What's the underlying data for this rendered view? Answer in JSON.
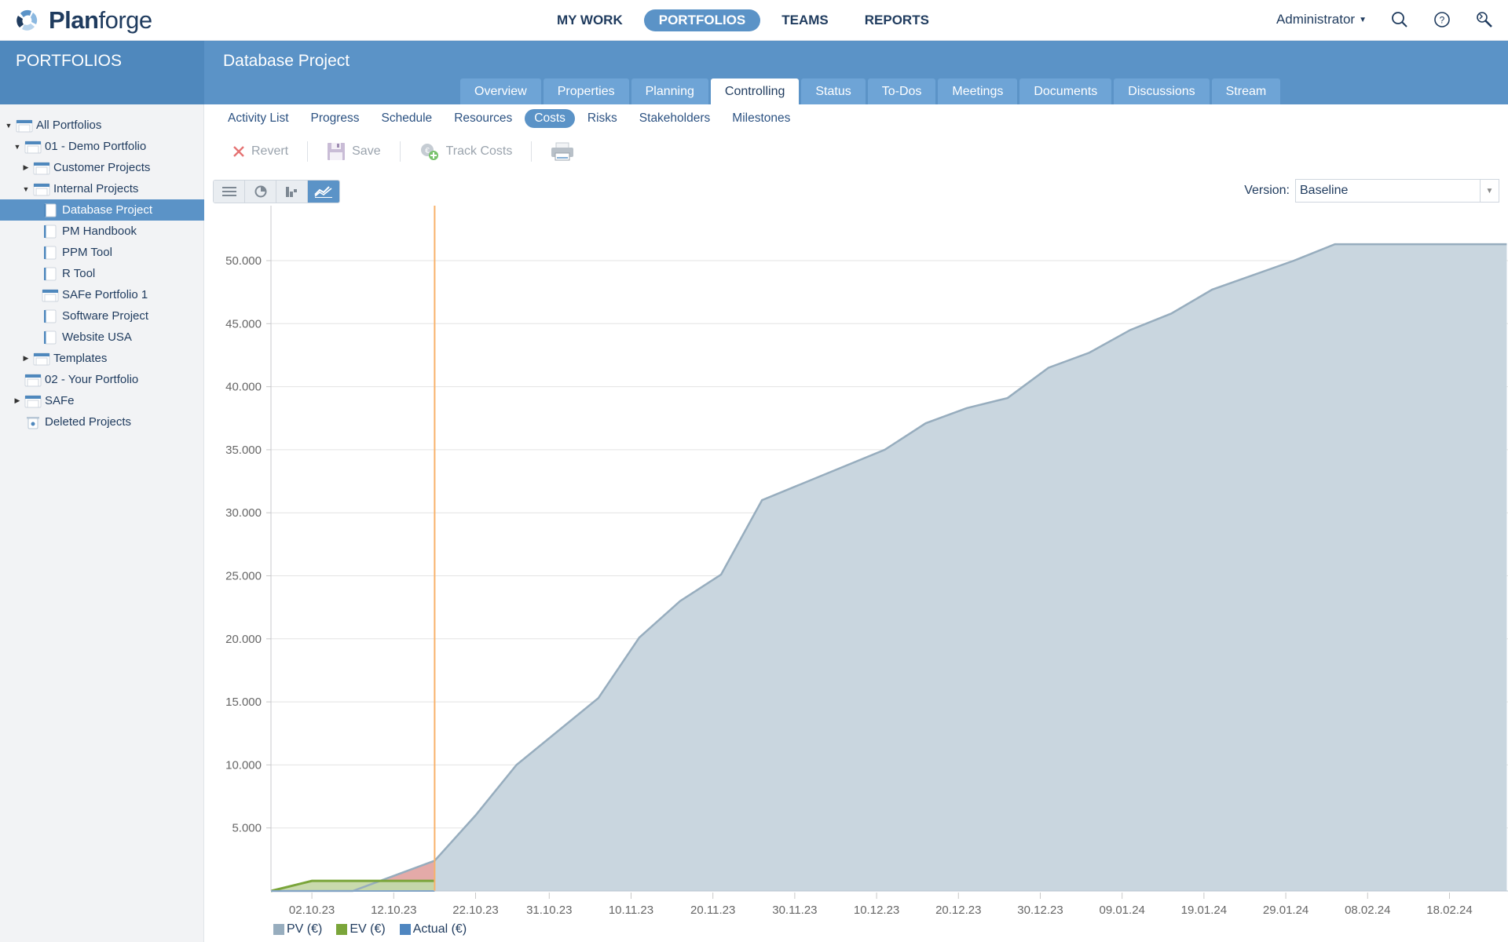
{
  "app": {
    "name_light": "Plan",
    "name_bold": "forge",
    "logo": "planforge-logo-icon"
  },
  "topnav": {
    "items": [
      {
        "label": "MY WORK",
        "active": false
      },
      {
        "label": "PORTFOLIOS",
        "active": true
      },
      {
        "label": "TEAMS",
        "active": false
      },
      {
        "label": "REPORTS",
        "active": false
      }
    ],
    "user": "Administrator",
    "icons": [
      "search-icon",
      "help-icon",
      "wrench-search-icon"
    ]
  },
  "sidebar": {
    "title": "PORTFOLIOS",
    "items": [
      {
        "label": "All Portfolios",
        "level": 0,
        "toggle": "open",
        "icon": "portfolio-icon"
      },
      {
        "label": "01 - Demo Portfolio",
        "level": 1,
        "toggle": "open",
        "icon": "portfolio-icon"
      },
      {
        "label": "Customer Projects",
        "level": 2,
        "toggle": "closed",
        "icon": "portfolio-icon"
      },
      {
        "label": "Internal Projects",
        "level": 2,
        "toggle": "open",
        "icon": "portfolio-icon"
      },
      {
        "label": "Database Project",
        "level": 3,
        "toggle": "none",
        "icon": "project-icon",
        "selected": true
      },
      {
        "label": "PM Handbook",
        "level": 3,
        "toggle": "none",
        "icon": "project-icon"
      },
      {
        "label": "PPM Tool",
        "level": 3,
        "toggle": "none",
        "icon": "project-icon"
      },
      {
        "label": "R Tool",
        "level": 3,
        "toggle": "none",
        "icon": "project-icon"
      },
      {
        "label": "SAFe Portfolio 1",
        "level": 3,
        "toggle": "none",
        "icon": "portfolio-icon"
      },
      {
        "label": "Software Project",
        "level": 3,
        "toggle": "none",
        "icon": "project-icon"
      },
      {
        "label": "Website USA",
        "level": 3,
        "toggle": "none",
        "icon": "project-icon"
      },
      {
        "label": "Templates",
        "level": 2,
        "toggle": "closed",
        "icon": "portfolio-icon"
      },
      {
        "label": "02 - Your Portfolio",
        "level": 1,
        "toggle": "none",
        "icon": "portfolio-icon"
      },
      {
        "label": "SAFe",
        "level": 1,
        "toggle": "closed",
        "icon": "portfolio-icon"
      },
      {
        "label": "Deleted Projects",
        "level": 1,
        "toggle": "none",
        "icon": "trash-icon"
      }
    ]
  },
  "project": {
    "title": "Database Project",
    "tabs": [
      {
        "label": "Overview",
        "active": false
      },
      {
        "label": "Properties",
        "active": false
      },
      {
        "label": "Planning",
        "active": false
      },
      {
        "label": "Controlling",
        "active": true
      },
      {
        "label": "Status",
        "active": false
      },
      {
        "label": "To-Dos",
        "active": false
      },
      {
        "label": "Meetings",
        "active": false
      },
      {
        "label": "Documents",
        "active": false
      },
      {
        "label": "Discussions",
        "active": false
      },
      {
        "label": "Stream",
        "active": false
      }
    ],
    "subtabs": [
      {
        "label": "Activity List",
        "active": false
      },
      {
        "label": "Progress",
        "active": false
      },
      {
        "label": "Schedule",
        "active": false
      },
      {
        "label": "Resources",
        "active": false
      },
      {
        "label": "Costs",
        "active": true
      },
      {
        "label": "Risks",
        "active": false
      },
      {
        "label": "Stakeholders",
        "active": false
      },
      {
        "label": "Milestones",
        "active": false
      }
    ]
  },
  "toolbar": {
    "revert": "Revert",
    "save": "Save",
    "track_costs": "Track Costs",
    "print": "print-icon"
  },
  "views": [
    {
      "name": "list-view-icon",
      "active": false
    },
    {
      "name": "pie-view-icon",
      "active": false
    },
    {
      "name": "bar-view-icon",
      "active": false
    },
    {
      "name": "line-view-icon",
      "active": true
    }
  ],
  "version": {
    "label": "Version:",
    "value": "Baseline"
  },
  "colors": {
    "accent": "#5b93c7",
    "pv": "#97adbe",
    "pv_fill": "#c9d6df",
    "ev": "#7aa53a",
    "ev_fill": "#c3d6a4",
    "actual": "#4f86c0",
    "variance_fill": "#e4aaa8",
    "today_line": "#f8b26a"
  },
  "chart_data": {
    "type": "area",
    "title": "",
    "xlabel": "",
    "ylabel": "",
    "x_range": [
      "27.09.23",
      "25.02.24"
    ],
    "ylim": [
      0,
      53000
    ],
    "grid": true,
    "today_marker": "17.10.23",
    "x_ticks": [
      "02.10.23",
      "12.10.23",
      "22.10.23",
      "31.10.23",
      "10.11.23",
      "20.11.23",
      "30.11.23",
      "10.12.23",
      "20.12.23",
      "30.12.23",
      "09.01.24",
      "19.01.24",
      "29.01.24",
      "08.02.24",
      "18.02.24"
    ],
    "y_ticks": [
      5000,
      10000,
      15000,
      20000,
      25000,
      30000,
      35000,
      40000,
      45000,
      50000
    ],
    "y_tick_labels": [
      "5.000",
      "10.000",
      "15.000",
      "20.000",
      "25.000",
      "30.000",
      "35.000",
      "40.000",
      "45.000",
      "50.000"
    ],
    "legend": {
      "placement": "bottom-left",
      "entries": [
        "PV (€)",
        "EV (€)",
        "Actual (€)"
      ]
    },
    "series": [
      {
        "name": "PV (€)",
        "points": [
          [
            "27.09.23",
            0
          ],
          [
            "07.10.23",
            0
          ],
          [
            "17.10.23",
            2400
          ],
          [
            "22.10.23",
            6000
          ],
          [
            "27.10.23",
            10000
          ],
          [
            "06.11.23",
            15300
          ],
          [
            "11.11.23",
            20100
          ],
          [
            "16.11.23",
            23000
          ],
          [
            "21.11.23",
            25100
          ],
          [
            "26.11.23",
            31000
          ],
          [
            "11.12.23",
            35000
          ],
          [
            "16.12.23",
            37100
          ],
          [
            "21.12.23",
            38300
          ],
          [
            "26.12.23",
            39100
          ],
          [
            "31.12.23",
            41500
          ],
          [
            "05.01.24",
            42700
          ],
          [
            "10.01.24",
            44500
          ],
          [
            "15.01.24",
            45800
          ],
          [
            "20.01.24",
            47700
          ],
          [
            "30.01.24",
            50000
          ],
          [
            "04.02.24",
            51300
          ],
          [
            "25.02.24",
            51300
          ]
        ]
      },
      {
        "name": "EV (€)",
        "points": [
          [
            "27.09.23",
            0
          ],
          [
            "02.10.23",
            800
          ],
          [
            "17.10.23",
            800
          ]
        ]
      },
      {
        "name": "Actual (€)",
        "points": [
          [
            "27.09.23",
            0
          ],
          [
            "17.10.23",
            0
          ]
        ]
      }
    ]
  }
}
